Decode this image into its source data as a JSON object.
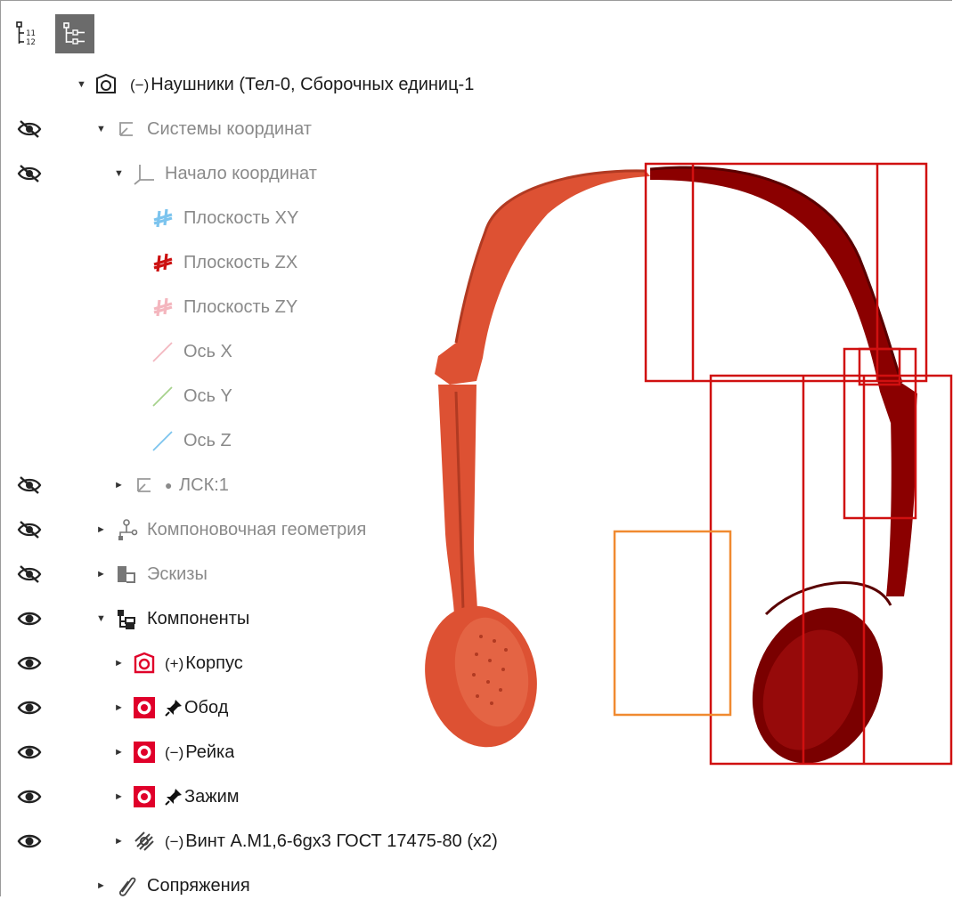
{
  "toolbar": {
    "buttons": [
      {
        "name": "list-view",
        "active": false
      },
      {
        "name": "tree-view",
        "active": true
      }
    ]
  },
  "tree": {
    "root": {
      "state": "(−)",
      "label": "Наушники (Тел-0, Сборочных единиц-1"
    },
    "nodes": [
      {
        "key": "cs",
        "label": "Системы координат",
        "hidden": true,
        "expanded": true
      },
      {
        "key": "origin",
        "label": "Начало координат",
        "hidden": true,
        "expanded": true
      },
      {
        "key": "plane-xy",
        "label": "Плоскость XY"
      },
      {
        "key": "plane-zx",
        "label": "Плоскость ZX"
      },
      {
        "key": "plane-zy",
        "label": "Плоскость ZY"
      },
      {
        "key": "axis-x",
        "label": "Ось X"
      },
      {
        "key": "axis-y",
        "label": "Ось Y"
      },
      {
        "key": "axis-z",
        "label": "Ось Z"
      },
      {
        "key": "lsk",
        "label": "ЛСК:1",
        "hidden": true,
        "expanded": false
      },
      {
        "key": "layout-geom",
        "label": "Компоновочная геометрия",
        "hidden": true,
        "expanded": false
      },
      {
        "key": "sketches",
        "label": "Эскизы",
        "hidden": true,
        "expanded": false
      },
      {
        "key": "components",
        "label": "Компоненты",
        "hidden": false,
        "expanded": true
      },
      {
        "key": "korpus",
        "state": "(+)",
        "label": "Корпус",
        "hidden": false,
        "expanded": false
      },
      {
        "key": "obod",
        "label": "Обод",
        "hidden": false,
        "expanded": false
      },
      {
        "key": "reyka",
        "state": "(−)",
        "label": "Рейка",
        "hidden": false,
        "expanded": false
      },
      {
        "key": "zazhim",
        "label": "Зажим",
        "hidden": false,
        "expanded": false
      },
      {
        "key": "vint",
        "state": "(−)",
        "label": "Винт А.М1,6-6gx3 ГОСТ 17475-80 (x2)",
        "hidden": false,
        "expanded": false
      },
      {
        "key": "mates",
        "label": "Сопряжения",
        "expanded": false
      }
    ]
  },
  "colors": {
    "plane_xy": "#7cc4ee",
    "plane_zx": "#cc1111",
    "plane_zy": "#f4b6be",
    "axis_x": "#f3b7c0",
    "axis_y": "#a6d28c",
    "axis_z": "#7cc4ee",
    "component_red": "#e0002a",
    "selected_model": "#dd5133",
    "model_dark": "#8b0000",
    "bbox_red": "#d01010",
    "bbox_orange": "#f08a30"
  }
}
